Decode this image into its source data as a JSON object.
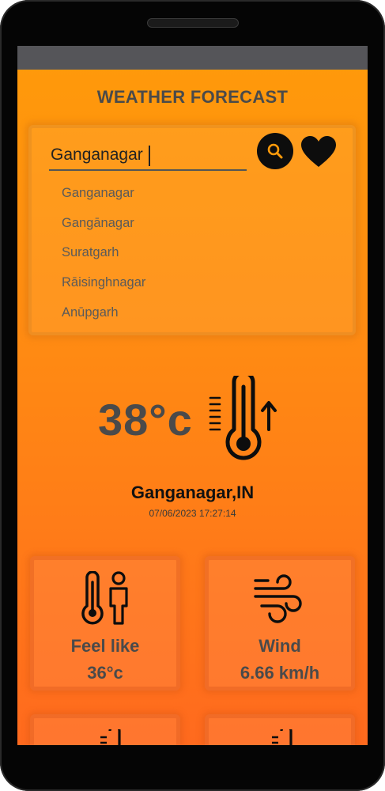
{
  "app": {
    "title": "WEATHER FORECAST"
  },
  "search": {
    "value": "Ganganagar",
    "suggestions": [
      "Ganganagar",
      "Gangānagar",
      "Suratgarh",
      "Rāisinghnagar",
      "Anūpgarh"
    ]
  },
  "current": {
    "temperature": "38°c",
    "location": "Ganganagar,IN",
    "datetime": "07/06/2023 17:27:14"
  },
  "tiles": [
    {
      "label": "Feel like",
      "value": "36°c",
      "icon": "thermometer-person-icon"
    },
    {
      "label": "Wind",
      "value": "6.66 km/h",
      "icon": "wind-icon"
    }
  ],
  "colors": {
    "bg_top": "#ff9a0a",
    "bg_bottom": "#ff6a1e",
    "text_dark": "#4a4a4a"
  }
}
